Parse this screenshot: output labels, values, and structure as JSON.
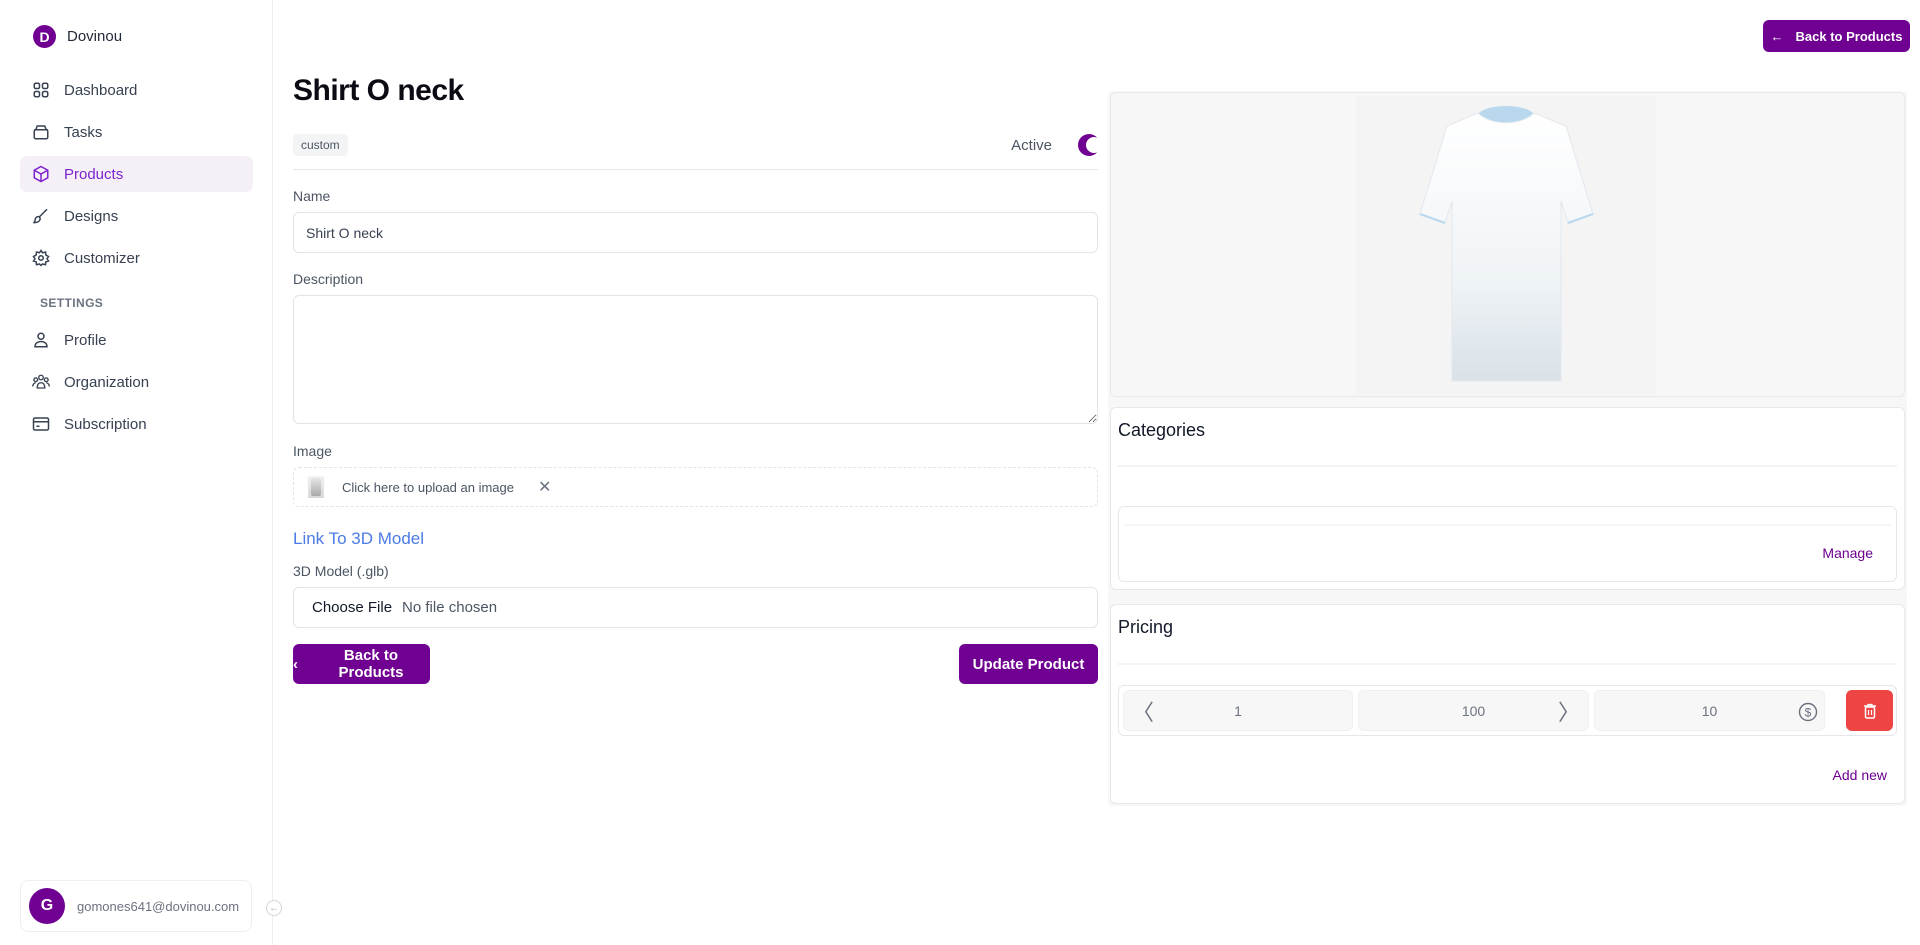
{
  "brand": {
    "initial": "D",
    "name": "Dovinou"
  },
  "sidebar": {
    "items": [
      {
        "label": "Dashboard",
        "icon": "grid-icon",
        "active": false
      },
      {
        "label": "Tasks",
        "icon": "tray-icon",
        "active": false
      },
      {
        "label": "Products",
        "icon": "cube-icon",
        "active": true
      },
      {
        "label": "Designs",
        "icon": "brush-icon",
        "active": false
      },
      {
        "label": "Customizer",
        "icon": "gear-icon",
        "active": false
      }
    ],
    "settings_header": "SETTINGS",
    "settings_items": [
      {
        "label": "Profile",
        "icon": "user-icon"
      },
      {
        "label": "Organization",
        "icon": "users-icon"
      },
      {
        "label": "Subscription",
        "icon": "credit-card-icon"
      }
    ],
    "user": {
      "initial": "G",
      "email": "gomones641@dovinou.com"
    }
  },
  "header": {
    "back_label": "Back to Products"
  },
  "product": {
    "title": "Shirt O neck",
    "type_badge": "custom",
    "active_label": "Active",
    "active": true
  },
  "form": {
    "name_label": "Name",
    "name_value": "Shirt O neck",
    "description_label": "Description",
    "description_value": "",
    "image_label": "Image",
    "upload_text": "Click here to upload an image",
    "link_3d": "Link To 3D Model",
    "model_label": "3D Model (.glb)",
    "file_button": "Choose File",
    "file_status": "No file chosen",
    "back_label": "Back to Products",
    "update_label": "Update Product"
  },
  "categories": {
    "title": "Categories",
    "manage_label": "Manage"
  },
  "pricing": {
    "title": "Pricing",
    "rows": [
      {
        "min": "1",
        "max": "100",
        "price": "10"
      }
    ],
    "add_label": "Add new"
  },
  "colors": {
    "brand": "#6f0091",
    "danger": "#ef4444",
    "link": "#4b7be5"
  }
}
